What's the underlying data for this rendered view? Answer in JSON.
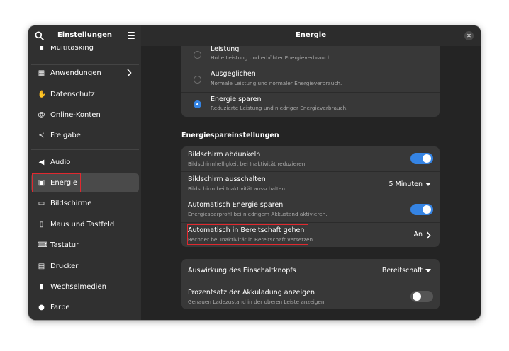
{
  "sidebar": {
    "title": "Einstellungen",
    "items": [
      {
        "label": "Multitasking",
        "icon": "multitasking-icon",
        "glyph": "▪"
      },
      {
        "label": "Anwendungen",
        "icon": "apps-grid-icon",
        "glyph": "▦"
      },
      {
        "label": "Datenschutz",
        "icon": "privacy-hand-icon",
        "glyph": "✋"
      },
      {
        "label": "Online-Konten",
        "icon": "at-sign-icon",
        "glyph": "@"
      },
      {
        "label": "Freigabe",
        "icon": "share-icon",
        "glyph": "≺"
      },
      {
        "label": "Audio",
        "icon": "speaker-icon",
        "glyph": "◀"
      },
      {
        "label": "Energie",
        "icon": "battery-icon",
        "glyph": "▣"
      },
      {
        "label": "Bildschirme",
        "icon": "display-icon",
        "glyph": "▭"
      },
      {
        "label": "Maus und Tastfeld",
        "icon": "mouse-icon",
        "glyph": "▯"
      },
      {
        "label": "Tastatur",
        "icon": "keyboard-icon",
        "glyph": "⌨"
      },
      {
        "label": "Drucker",
        "icon": "printer-icon",
        "glyph": "▤"
      },
      {
        "label": "Wechselmedien",
        "icon": "usb-icon",
        "glyph": "▮"
      },
      {
        "label": "Farbe",
        "icon": "color-icon",
        "glyph": "●"
      }
    ]
  },
  "main": {
    "title": "Energie",
    "modes": [
      {
        "title": "Leistung",
        "subtitle": "Hohe Leistung und erhöhter Energieverbrauch.",
        "selected": false
      },
      {
        "title": "Ausgeglichen",
        "subtitle": "Normale Leistung und normaler Energieverbrauch.",
        "selected": false
      },
      {
        "title": "Energie sparen",
        "subtitle": "Reduzierte Leistung und niedriger Energieverbrauch.",
        "selected": true
      }
    ],
    "section_title": "Energiespareinstellungen",
    "saving": [
      {
        "title": "Bildschirm abdunkeln",
        "subtitle": "Bildschirmhelligkeit bei Inaktivität reduzieren.",
        "toggle": true
      },
      {
        "title": "Bildschirm ausschalten",
        "subtitle": "Bildschirm bei Inaktivität ausschalten.",
        "value": "5 Minuten"
      },
      {
        "title": "Automatisch Energie sparen",
        "subtitle": "Energiesparprofil bei niedrigem Akkustand aktivieren.",
        "toggle": true
      },
      {
        "title": "Automatisch in Bereitschaft gehen",
        "subtitle": "Rechner bei Inaktivität in Bereitschaft versetzen.",
        "value": "An"
      }
    ],
    "power_button": {
      "title": "Auswirkung des Einschaltknopfs",
      "value": "Bereitschaft"
    },
    "battery_percent": {
      "title": "Prozentsatz der Akkuladung anzeigen",
      "subtitle": "Genauen Ladezustand in der oberen Leiste anzeigen",
      "toggle": false
    }
  },
  "colors": {
    "accent": "#3584e4",
    "highlight": "#e0292f",
    "sidebar": "#303030",
    "card": "#383838"
  }
}
